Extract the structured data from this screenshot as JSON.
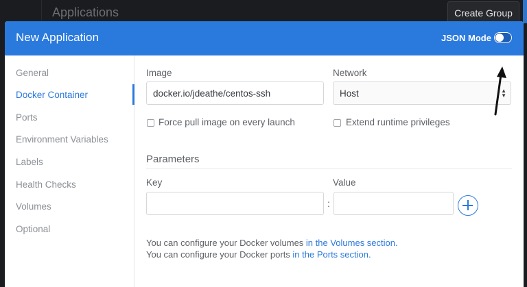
{
  "background": {
    "title": "Applications",
    "create_group": "Create Group"
  },
  "modal": {
    "title": "New Application",
    "json_mode_label": "JSON Mode",
    "json_mode_on": false
  },
  "sidebar": {
    "items": [
      {
        "label": "General",
        "active": false
      },
      {
        "label": "Docker Container",
        "active": true
      },
      {
        "label": "Ports",
        "active": false
      },
      {
        "label": "Environment Variables",
        "active": false
      },
      {
        "label": "Labels",
        "active": false
      },
      {
        "label": "Health Checks",
        "active": false
      },
      {
        "label": "Volumes",
        "active": false
      },
      {
        "label": "Optional",
        "active": false
      }
    ]
  },
  "form": {
    "image_label": "Image",
    "image_value": "docker.io/jdeathe/centos-ssh",
    "network_label": "Network",
    "network_value": "Host",
    "force_pull_label": "Force pull image on every launch",
    "extend_privileges_label": "Extend runtime privileges",
    "parameters_title": "Parameters",
    "key_label": "Key",
    "value_label": "Value",
    "key_value": "",
    "value_value": "",
    "separator": ":"
  },
  "help": {
    "volumes_text": "You can configure your Docker volumes ",
    "volumes_link": "in the Volumes section.",
    "ports_text": "You can configure your Docker ports ",
    "ports_link": "in the Ports section."
  },
  "colors": {
    "accent": "#2a79dd",
    "background": "#1b1c1f"
  }
}
